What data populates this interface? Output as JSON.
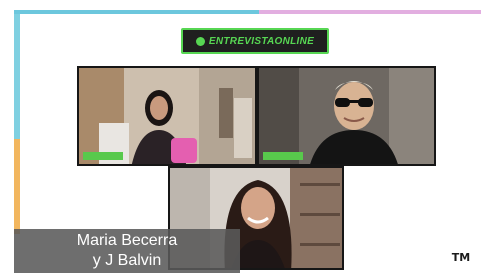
{
  "brand": {
    "logo_text": "ENTREVISTAONLINE",
    "accent_color": "#57d653"
  },
  "participants": [
    {
      "id": "participant-1",
      "name_tag": ""
    },
    {
      "id": "participant-2",
      "name_tag": ""
    },
    {
      "id": "participant-3",
      "name_tag": ""
    }
  ],
  "caption": {
    "line1": "Maria Becerra",
    "line2": "y J Balvin"
  },
  "corner_logo": {
    "text": "TM"
  },
  "colors": {
    "frame_cyan": "#7fd0e1",
    "frame_orange": "#f2b65e",
    "frame_pink": "#e2aee0",
    "caption_bg": "#5a5a5a"
  }
}
